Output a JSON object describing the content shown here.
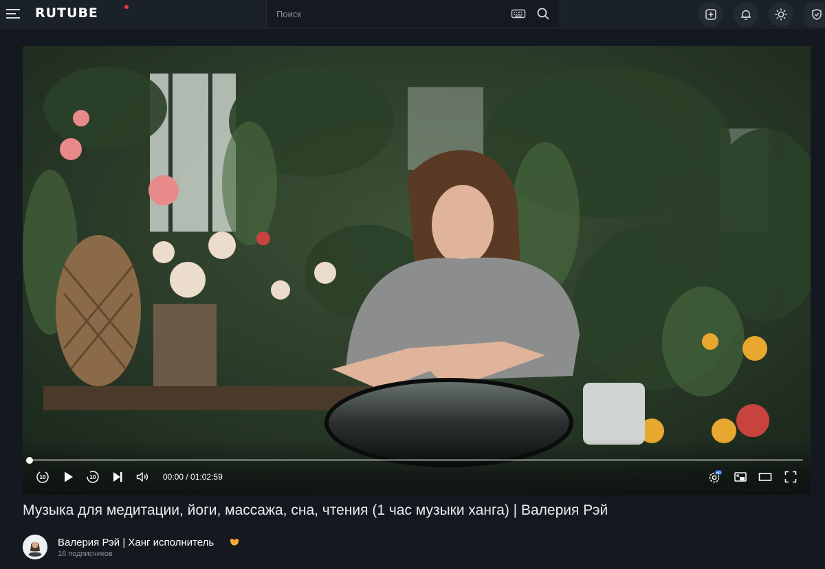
{
  "header": {
    "logo": "RUTUBE",
    "search_placeholder": "Поиск",
    "icons": [
      "menu-icon",
      "keyboard-icon",
      "search-icon",
      "upload-icon",
      "bell-icon",
      "theme-sun-icon",
      "shield-icon"
    ]
  },
  "player": {
    "time_current": "00:00",
    "time_total": "01:02:59",
    "progress": 0.0,
    "quality_badge_icon": "settings-hd-icon",
    "controls": [
      "rewind-10-icon",
      "play-icon",
      "forward-10-icon",
      "next-icon",
      "volume-icon",
      "settings-icon",
      "pip-icon",
      "theater-icon",
      "fullscreen-icon"
    ]
  },
  "video": {
    "title": "Музыка для медитации, йоги, массажа, сна, чтения (1 час музыки ханга) | Валерия Рэй"
  },
  "channel": {
    "name": "Валерия Рэй | Ханг исполнитель",
    "subscribers": "16 подписчиков",
    "badge_icon": "heart-hands-icon"
  },
  "colors": {
    "background": "#14191f",
    "header": "#1b2129",
    "accent": "#e8354a"
  }
}
